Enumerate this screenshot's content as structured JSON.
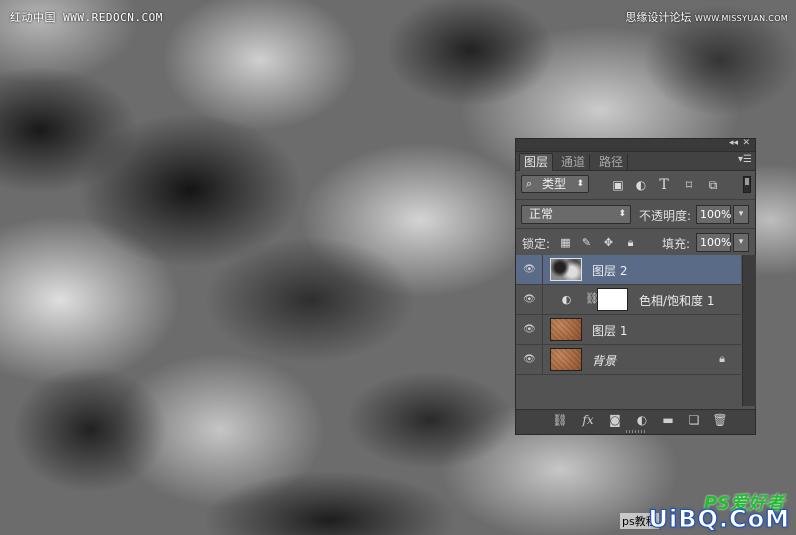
{
  "watermarks": {
    "top_left": "红动中国 WWW.REDOCN.COM",
    "top_right_cn": "思缘设计论坛",
    "top_right_url": "WWW.MISSYUAN.COM",
    "bottom_ps": "PS爱好者",
    "bottom_big": "UiBQ.CoM",
    "bottom_tiny": "ps教程"
  },
  "panel": {
    "tabs": [
      {
        "label": "图层",
        "active": true
      },
      {
        "label": "通道",
        "active": false
      },
      {
        "label": "路径",
        "active": false
      }
    ],
    "filter": {
      "label": "类型",
      "icons": [
        "image-filter-icon",
        "adjustment-filter-icon",
        "type-filter-icon",
        "shape-filter-icon",
        "smart-object-filter-icon"
      ]
    },
    "blend_mode": "正常",
    "opacity_label": "不透明度:",
    "opacity_value": "100%",
    "lock_label": "锁定:",
    "fill_label": "填充:",
    "fill_value": "100%",
    "layers": [
      {
        "name": "图层 2",
        "type": "pixel",
        "thumb": "clouds",
        "selected": true,
        "visible": true
      },
      {
        "name": "色相/饱和度 1",
        "type": "adjustment",
        "selected": false,
        "visible": true
      },
      {
        "name": "图层 1",
        "type": "pixel",
        "thumb": "texture",
        "selected": false,
        "visible": true
      },
      {
        "name": "背景",
        "type": "background",
        "thumb": "texture",
        "selected": false,
        "visible": true,
        "locked": true
      }
    ]
  },
  "colors": {
    "panel_bg": "#535353",
    "selected_layer": "#5a6b88",
    "bottom_watermark_blue": "#1d52b8",
    "bottom_watermark_green": "#1fbf2f"
  }
}
